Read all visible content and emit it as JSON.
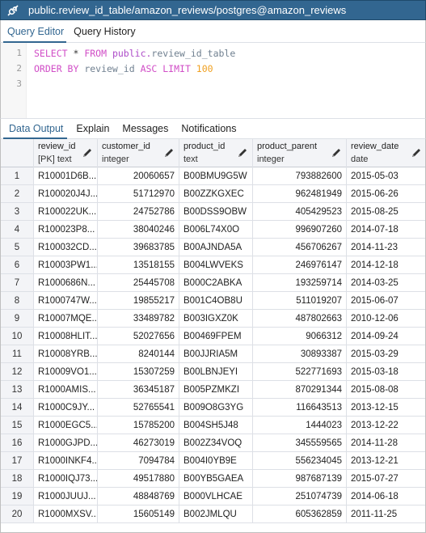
{
  "window": {
    "title": "public.review_id_table/amazon_reviews/postgres@amazon_reviews"
  },
  "query_tabs": [
    "Query Editor",
    "Query History"
  ],
  "editor": {
    "line_numbers": [
      "1",
      "2",
      "3"
    ],
    "line1": {
      "k1": "SELECT",
      "star": " * ",
      "k2": "FROM",
      "schema": " public.",
      "table": "review_id_table"
    },
    "line2": {
      "k1": "ORDER BY",
      "col": " review_id ",
      "k2": "ASC LIMIT",
      "n": " 100"
    }
  },
  "data_tabs": [
    "Data Output",
    "Explain",
    "Messages",
    "Notifications"
  ],
  "colors": {
    "accent": "#326690",
    "keyword": "#d14ec7",
    "number": "#f0a020"
  },
  "columns": [
    {
      "name": "review_id",
      "type": "[PK] text",
      "icon": "pencil-icon"
    },
    {
      "name": "customer_id",
      "type": "integer",
      "icon": "pencil-icon"
    },
    {
      "name": "product_id",
      "type": "text",
      "icon": "pencil-icon"
    },
    {
      "name": "product_parent",
      "type": "integer",
      "icon": "pencil-icon"
    },
    {
      "name": "review_date",
      "type": "date",
      "icon": "pencil-icon"
    }
  ],
  "rows": [
    [
      "1",
      "R10001D6B...",
      "20060657",
      "B00BMU9G5W",
      "793882600",
      "2015-05-03"
    ],
    [
      "2",
      "R100020J4J...",
      "51712970",
      "B00ZZKGXEC",
      "962481949",
      "2015-06-26"
    ],
    [
      "3",
      "R100022UK...",
      "24752786",
      "B00DSS9OBW",
      "405429523",
      "2015-08-25"
    ],
    [
      "4",
      "R100023P8...",
      "38040246",
      "B006L74X0O",
      "996907260",
      "2014-07-18"
    ],
    [
      "5",
      "R100032CD...",
      "39683785",
      "B00AJNDA5A",
      "456706267",
      "2014-11-23"
    ],
    [
      "6",
      "R10003PW1...",
      "13518155",
      "B004LWVEKS",
      "246976147",
      "2014-12-18"
    ],
    [
      "7",
      "R1000686N...",
      "25445708",
      "B000C2ABKA",
      "193259714",
      "2014-03-25"
    ],
    [
      "8",
      "R1000747W...",
      "19855217",
      "B001C4OB8U",
      "511019207",
      "2015-06-07"
    ],
    [
      "9",
      "R10007MQE...",
      "33489782",
      "B003IGXZ0K",
      "487802663",
      "2010-12-06"
    ],
    [
      "10",
      "R10008HLIT...",
      "52027656",
      "B00469FPEM",
      "9066312",
      "2014-09-24"
    ],
    [
      "11",
      "R10008YRB...",
      "8240144",
      "B00JJRIA5M",
      "30893387",
      "2015-03-29"
    ],
    [
      "12",
      "R10009VO1...",
      "15307259",
      "B00LBNJEYI",
      "522771693",
      "2015-03-18"
    ],
    [
      "13",
      "R1000AMIS...",
      "36345187",
      "B005PZMKZI",
      "870291344",
      "2015-08-08"
    ],
    [
      "14",
      "R1000C9JY...",
      "52765541",
      "B009O8G3YG",
      "116643513",
      "2013-12-15"
    ],
    [
      "15",
      "R1000EGC5...",
      "15785200",
      "B004SH5J48",
      "1444023",
      "2013-12-22"
    ],
    [
      "16",
      "R1000GJPD...",
      "46273019",
      "B002Z34VOQ",
      "345559565",
      "2014-11-28"
    ],
    [
      "17",
      "R1000INKF4...",
      "7094784",
      "B004I0YB9E",
      "556234045",
      "2013-12-21"
    ],
    [
      "18",
      "R1000IQJ73...",
      "49517880",
      "B00YB5GAEA",
      "987687139",
      "2015-07-27"
    ],
    [
      "19",
      "R1000JUUJ...",
      "48848769",
      "B000VLHCAE",
      "251074739",
      "2014-06-18"
    ],
    [
      "20",
      "R1000MXSV...",
      "15605149",
      "B002JMLQU",
      "605362859",
      "2011-11-25"
    ]
  ]
}
